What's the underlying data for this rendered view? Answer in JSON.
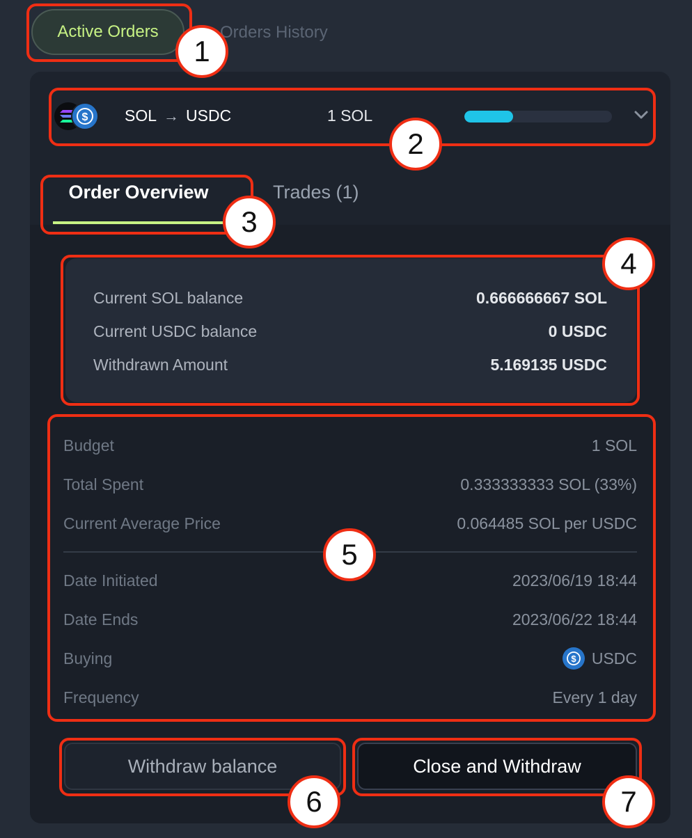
{
  "tabs": {
    "active_orders": "Active Orders",
    "orders_history": "Orders History"
  },
  "order": {
    "from_token": "SOL",
    "arrow": "→",
    "to_token": "USDC",
    "amount": "1 SOL",
    "progress_fraction": 0.33,
    "progress_color": "#1fc4e8"
  },
  "content_tabs": {
    "overview": "Order Overview",
    "trades": "Trades (1)"
  },
  "balances": [
    {
      "label": "Current SOL balance",
      "value": "0.666666667 SOL"
    },
    {
      "label": "Current USDC balance",
      "value": "0 USDC"
    },
    {
      "label": "Withdrawn Amount",
      "value": "5.169135 USDC"
    }
  ],
  "details": [
    {
      "label": "Budget",
      "value": "1 SOL"
    },
    {
      "label": "Total Spent",
      "value": "0.333333333 SOL (33%)"
    },
    {
      "label": "Current Average Price",
      "value": "0.064485 SOL per USDC"
    },
    {
      "label": "Date Initiated",
      "value": "2023/06/19 18:44"
    },
    {
      "label": "Date Ends",
      "value": "2023/06/22 18:44"
    },
    {
      "label": "Buying",
      "value": "USDC"
    },
    {
      "label": "Frequency",
      "value": "Every 1 day"
    }
  ],
  "buttons": {
    "withdraw": "Withdraw balance",
    "close": "Close and Withdraw"
  },
  "annotations": [
    "1",
    "2",
    "3",
    "4",
    "5",
    "6",
    "7"
  ],
  "colors": {
    "accent": "#c7f284",
    "annotation": "#ef2e14",
    "usdc": "#2775ca"
  }
}
